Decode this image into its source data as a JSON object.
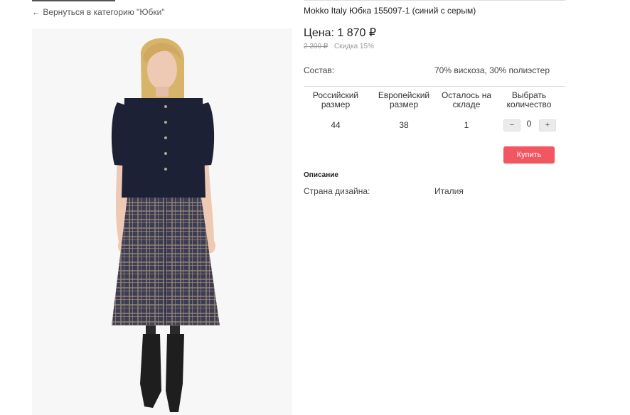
{
  "nav": {
    "back_link": "← Вернуться в категорию \"Юбки\""
  },
  "product": {
    "title": "Mokko Italy Юбка 155097-1 (синий с серым)",
    "price_label": "Цена:",
    "price_value": "1 870",
    "currency": "₽",
    "old_price": "2 200 ₽",
    "discount": "Скидка 15%"
  },
  "specs": {
    "composition_label": "Состав:",
    "composition_value": "70% вискоза, 30% полиэстер"
  },
  "table": {
    "headers": [
      "Российский размер",
      "Европейский размер",
      "Осталось на складе",
      "Выбрать количество"
    ],
    "row": {
      "ru_size": "44",
      "eu_size": "38",
      "stock": "1",
      "quantity": "0"
    },
    "minus": "−",
    "plus": "+"
  },
  "buy_button": "Купить",
  "description": {
    "heading": "Описание",
    "country_label": "Страна дизайна:",
    "country_value": "Италия"
  },
  "colors": {
    "accent": "#f25660",
    "blouse": "#1d2136",
    "skirt": "#3b3d52",
    "skin": "#eec9b4",
    "hair": "#d8b46a",
    "boots": "#1e1e1e"
  }
}
